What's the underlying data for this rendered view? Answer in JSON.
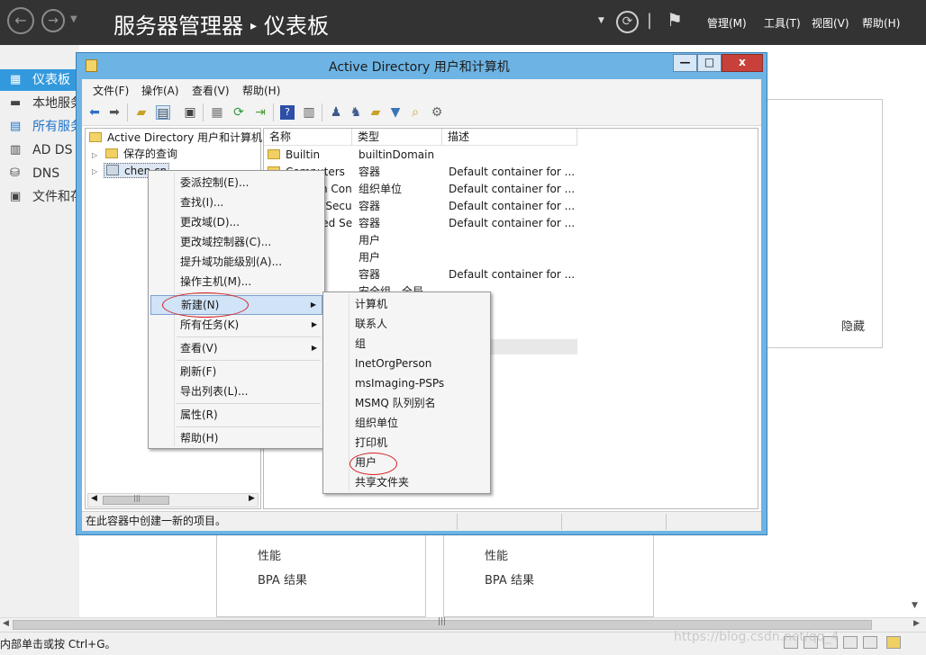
{
  "server_manager": {
    "title": "服务器管理器",
    "title_sep": "▸",
    "subtitle": "仪表板",
    "menus": [
      "管理(M)",
      "工具(T)",
      "视图(V)",
      "帮助(H)"
    ],
    "sidebar": [
      {
        "label": "仪表板",
        "icon": "dashboard-icon",
        "state": "active"
      },
      {
        "label": "本地服务器",
        "icon": "local-server-icon",
        "state": "normal"
      },
      {
        "label": "所有服务器",
        "icon": "all-servers-icon",
        "state": "highlight"
      },
      {
        "label": "AD DS",
        "icon": "ad-ds-icon",
        "state": "normal"
      },
      {
        "label": "DNS",
        "icon": "dns-icon",
        "state": "normal"
      },
      {
        "label": "文件和存储服务",
        "icon": "file-storage-icon",
        "state": "normal"
      }
    ],
    "hide_label": "隐藏",
    "tiles": [
      {
        "perf": "性能",
        "bpa": "BPA 结果"
      },
      {
        "perf": "性能",
        "bpa": "BPA 结果"
      }
    ],
    "statusbar_text": "内部单击或按 Ctrl+G。",
    "watermark": "https://blog.csdn.net/qq_4"
  },
  "aduc": {
    "title": "Active Directory 用户和计算机",
    "controls": {
      "minimize": "—",
      "maximize": "□",
      "close": "x"
    },
    "menubar": [
      "文件(F)",
      "操作(A)",
      "查看(V)",
      "帮助(H)"
    ],
    "toolbar_icons": [
      "back-icon",
      "forward-icon",
      "up-folder-icon",
      "show-tree-icon",
      "properties-icon",
      "export-icon",
      "refresh-icon",
      "export-list-icon",
      "help-icon",
      "console-icon",
      "new-user-icon",
      "new-group-icon",
      "new-ou-icon",
      "filter-icon",
      "find-icon",
      "delegate-icon"
    ],
    "tree": {
      "root": "Active Directory 用户和计算机",
      "saved_queries": "保存的查询",
      "domain": "chen.cn"
    },
    "columns": [
      "名称",
      "类型",
      "描述"
    ],
    "rows": [
      {
        "name": "Builtin",
        "type": "builtinDomain",
        "desc": ""
      },
      {
        "name": "Computers",
        "type": "容器",
        "desc": "Default container for ..."
      },
      {
        "name": "Domain Controllers",
        "type": "组织单位",
        "desc": "Default container for ..."
      },
      {
        "name": "ForeignSecurityPrincipals",
        "type": "容器",
        "desc": "Default container for ..."
      },
      {
        "name": "Managed Service Accounts",
        "type": "容器",
        "desc": "Default container for ..."
      },
      {
        "name": "",
        "type": "用户",
        "desc": ""
      },
      {
        "name": "",
        "type": "用户",
        "desc": ""
      },
      {
        "name": "",
        "type": "容器",
        "desc": "Default container for ..."
      },
      {
        "name": "",
        "type": "安全组 - 全局",
        "desc": ""
      }
    ],
    "status_text": "在此容器中创建一新的项目。"
  },
  "context_menu": {
    "items": [
      {
        "label": "委派控制(E)...",
        "submenu": false
      },
      {
        "label": "查找(I)...",
        "submenu": false
      },
      {
        "label": "更改域(D)...",
        "submenu": false
      },
      {
        "label": "更改域控制器(C)...",
        "submenu": false
      },
      {
        "label": "提升域功能级别(A)...",
        "submenu": false
      },
      {
        "label": "操作主机(M)...",
        "submenu": false
      },
      {
        "label": "新建(N)",
        "submenu": true,
        "selected": true
      },
      {
        "label": "所有任务(K)",
        "submenu": true
      },
      {
        "label": "查看(V)",
        "submenu": true
      },
      {
        "label": "刷新(F)",
        "submenu": false
      },
      {
        "label": "导出列表(L)...",
        "submenu": false
      },
      {
        "label": "属性(R)",
        "submenu": false
      },
      {
        "label": "帮助(H)",
        "submenu": false
      }
    ]
  },
  "submenu_new": {
    "items": [
      "计算机",
      "联系人",
      "组",
      "InetOrgPerson",
      "msImaging-PSPs",
      "MSMQ 队列别名",
      "组织单位",
      "打印机",
      "用户",
      "共享文件夹"
    ]
  },
  "colors": {
    "sm_titlebar": "#333333",
    "sidebar_active": "#3399dd",
    "window_frame": "#6db4e4",
    "close_button": "#c7413a",
    "annotation_ellipse": "#d42020"
  }
}
